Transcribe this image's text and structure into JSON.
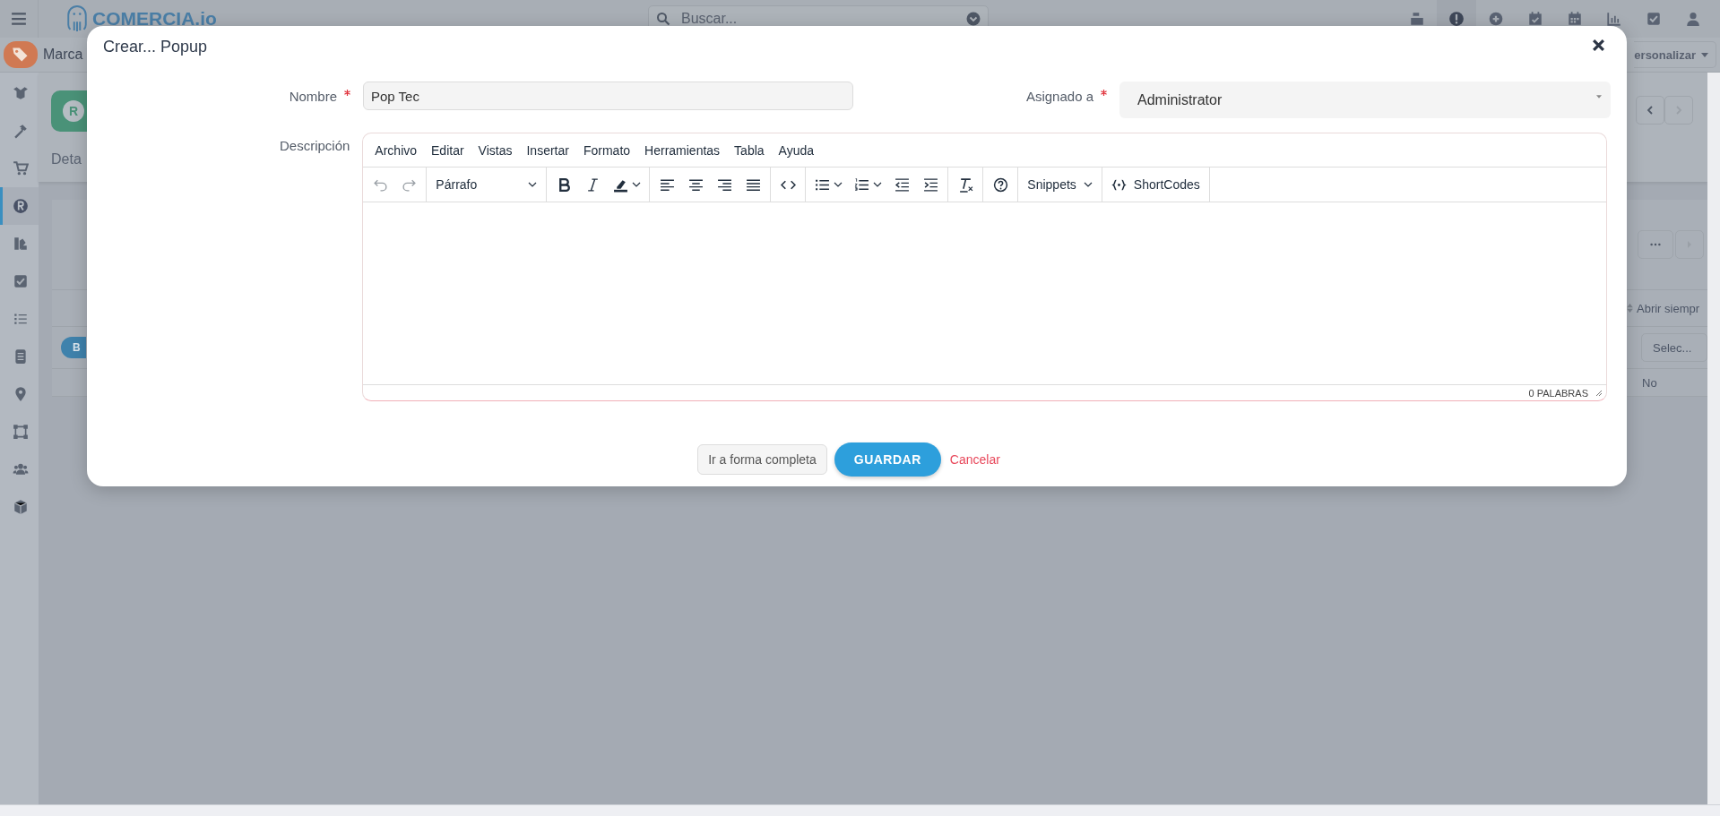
{
  "app": {
    "logo": "COMERCIA.io",
    "search": {
      "placeholder": "Buscar..."
    },
    "top_icons": [
      {
        "kind": "register",
        "selected": false
      },
      {
        "kind": "alert",
        "selected": true
      },
      {
        "kind": "plus",
        "selected": false
      },
      {
        "kind": "calendar-check",
        "selected": false
      },
      {
        "kind": "calendar",
        "selected": false
      },
      {
        "kind": "chart",
        "selected": false
      },
      {
        "kind": "check",
        "selected": false
      },
      {
        "kind": "user",
        "selected": false
      }
    ],
    "module_title": "Marca",
    "customize_button": "ersonalizar",
    "sidebar": [
      {
        "kind": "box",
        "selected": false
      },
      {
        "kind": "hammer",
        "selected": false
      },
      {
        "kind": "cart",
        "selected": false
      },
      {
        "kind": "r",
        "selected": true
      },
      {
        "kind": "swatch",
        "selected": false
      },
      {
        "kind": "check",
        "selected": false
      },
      {
        "kind": "list",
        "selected": false
      },
      {
        "kind": "cabinet",
        "selected": false
      },
      {
        "kind": "pin",
        "selected": false
      },
      {
        "kind": "frame",
        "selected": false
      },
      {
        "kind": "users",
        "selected": false
      },
      {
        "kind": "cube",
        "selected": false
      }
    ],
    "record_avatar": "R",
    "record_tab": "Deta",
    "column_heading": "Abrir siempr",
    "pill_button": "B",
    "select_field": "Selec...",
    "cell": "No"
  },
  "popup": {
    "title": "Crear... Popup",
    "fields": [
      {
        "label": "Nombre",
        "required": true,
        "value": "Pop Tec"
      },
      {
        "label": "Asignado a",
        "required": true,
        "value": "Administrator"
      }
    ],
    "description": {
      "label": "Descripción",
      "menu": [
        "Archivo",
        "Editar",
        "Vistas",
        "Insertar",
        "Formato",
        "Herramientas",
        "Tabla",
        "Ayuda"
      ],
      "toolbar": [
        [
          {
            "kind": "undo",
            "disabled": true
          },
          {
            "kind": "redo",
            "disabled": true
          }
        ],
        [
          {
            "kind": "block",
            "label": "Párrafo",
            "disabled": false
          }
        ],
        [
          {
            "kind": "bold",
            "disabled": false
          },
          {
            "kind": "italic",
            "disabled": false
          },
          {
            "kind": "highlight",
            "disabled": false
          }
        ],
        [
          {
            "kind": "align-left",
            "disabled": false
          },
          {
            "kind": "align-center",
            "disabled": false
          },
          {
            "kind": "align-right",
            "disabled": false
          },
          {
            "kind": "justify",
            "disabled": false
          }
        ],
        [
          {
            "kind": "code",
            "disabled": false
          }
        ],
        [
          {
            "kind": "bullets",
            "disabled": false
          },
          {
            "kind": "numbers",
            "disabled": false
          },
          {
            "kind": "outdent",
            "disabled": false
          },
          {
            "kind": "indent",
            "disabled": false
          }
        ],
        [
          {
            "kind": "clear",
            "disabled": false
          }
        ],
        [
          {
            "kind": "help",
            "disabled": false
          }
        ],
        [
          {
            "kind": "dropdown",
            "label": "Snippets",
            "disabled": false
          }
        ],
        [
          {
            "kind": "shortcodes",
            "label": "ShortCodes",
            "disabled": false
          }
        ]
      ],
      "word_count": "0 PALABRAS"
    },
    "buttons": {
      "full_form": "Ir a forma completa",
      "save": "GUARDAR",
      "cancel": "Cancelar"
    }
  }
}
